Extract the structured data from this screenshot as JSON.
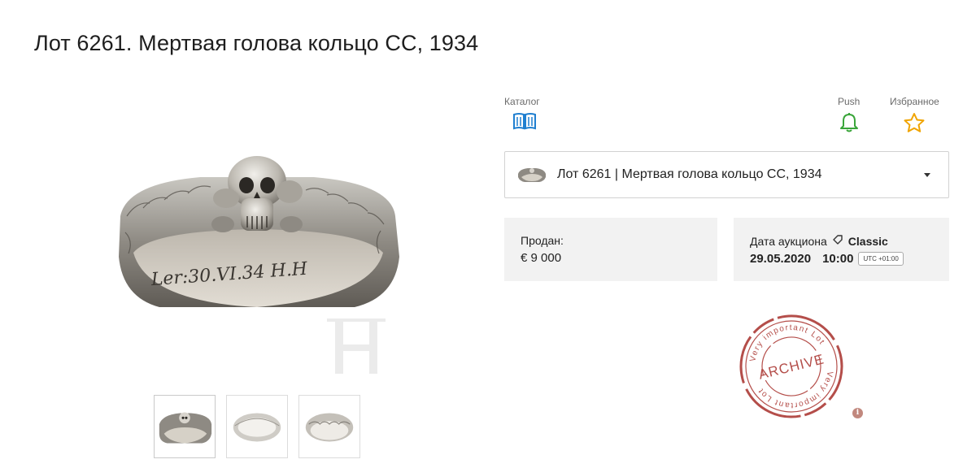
{
  "page": {
    "title": "Лот 6261. Мертвая голова кольцо СС, 1934"
  },
  "gallery": {
    "watermark": "H",
    "engraving": "Ler:30.VI.34 H.H",
    "thumbnails": [
      {
        "name": "thumb-ring-front",
        "active": true
      },
      {
        "name": "thumb-ring-side",
        "active": false
      },
      {
        "name": "thumb-ring-back",
        "active": false
      }
    ]
  },
  "actions": {
    "catalog": {
      "label": "Каталог",
      "icon": "book-icon",
      "color": "#1f7fd0"
    },
    "push": {
      "label": "Push",
      "icon": "bell-icon",
      "color": "#3aa53a"
    },
    "favorites": {
      "label": "Избранное",
      "icon": "star-icon",
      "color": "#f0a400"
    }
  },
  "lot_select": {
    "text": "Лот 6261 | Мертвая голова кольцо СС, 1934"
  },
  "sold": {
    "label": "Продан:",
    "value": "€ 9 000"
  },
  "auction": {
    "label": "Дата аукциона",
    "type": "Classic",
    "date": "29.05.2020",
    "time": "10:00",
    "timezone": "UTC +01:00"
  },
  "stamp": {
    "center_text": "ARCHIVE",
    "ring_text": "Very important Lot",
    "color": "#a8302b"
  }
}
